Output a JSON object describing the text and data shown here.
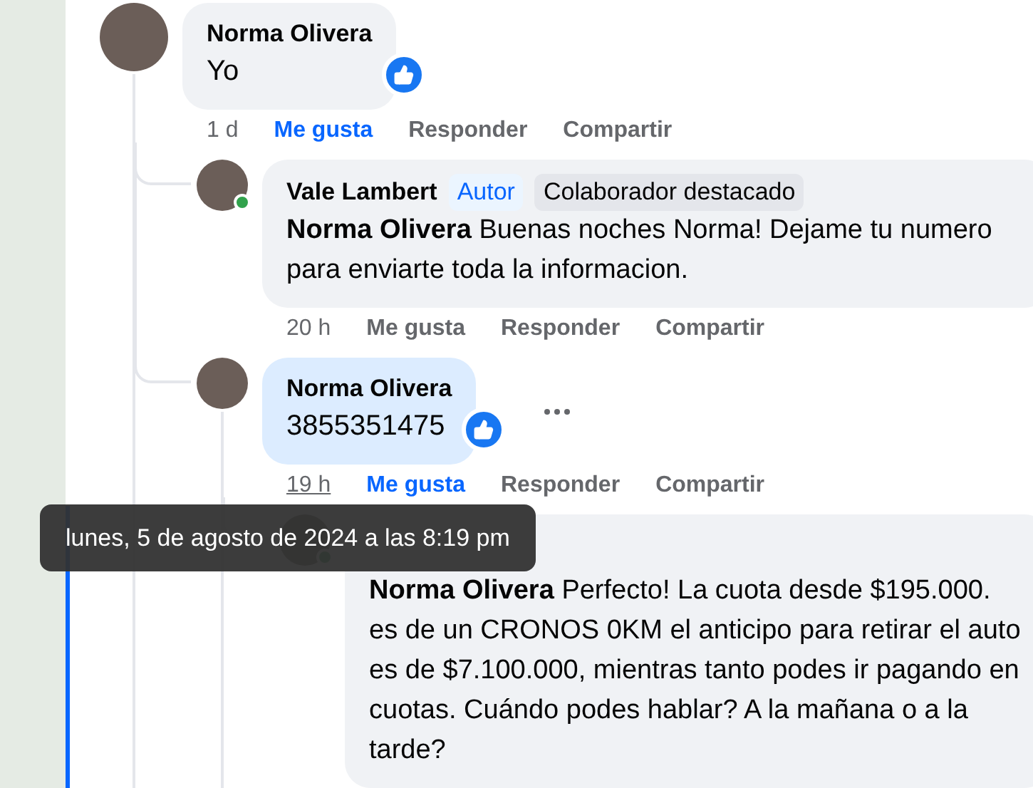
{
  "comments": [
    {
      "author": "Norma Olivera",
      "text": "Yo",
      "reaction": true,
      "time": "1 d",
      "actions": [
        {
          "label": "Me gusta",
          "selected": true
        },
        {
          "label": "Responder",
          "selected": false
        },
        {
          "label": "Compartir",
          "selected": false
        }
      ],
      "children": [
        {
          "author": "Vale Lambert",
          "badges": [
            {
              "label": "Autor",
              "kind": "author"
            },
            {
              "label": "Colaborador destacado",
              "kind": "top"
            }
          ],
          "mention": "Norma Olivera",
          "text": "Buenas noches Norma! Dejame tu numero para enviarte toda la informacion.",
          "online": true,
          "time": "20 h",
          "actions": [
            {
              "label": "Me gusta",
              "selected": false
            },
            {
              "label": "Responder",
              "selected": false
            },
            {
              "label": "Compartir",
              "selected": false
            }
          ]
        },
        {
          "author": "Norma Olivera",
          "text": "3855351475",
          "highlighted": true,
          "reaction": true,
          "more_menu": true,
          "time": "19 h",
          "time_hovered": true,
          "actions": [
            {
              "label": "Me gusta",
              "selected": true
            },
            {
              "label": "Responder",
              "selected": false
            },
            {
              "label": "Compartir",
              "selected": false
            }
          ],
          "children": [
            {
              "mention": "Norma Olivera",
              "text": "Perfecto! La cuota desde $195.000. es de un CRONOS 0KM el anticipo para retirar el auto es de $7.100.000, mientras tanto podes ir pagando en cuotas. Cuándo podes hablar? A la mañana o a la tarde?",
              "online": true
            }
          ]
        }
      ]
    }
  ],
  "tooltip": {
    "text": "lunes, 5 de agosto de 2024 a las 8:19 pm"
  }
}
